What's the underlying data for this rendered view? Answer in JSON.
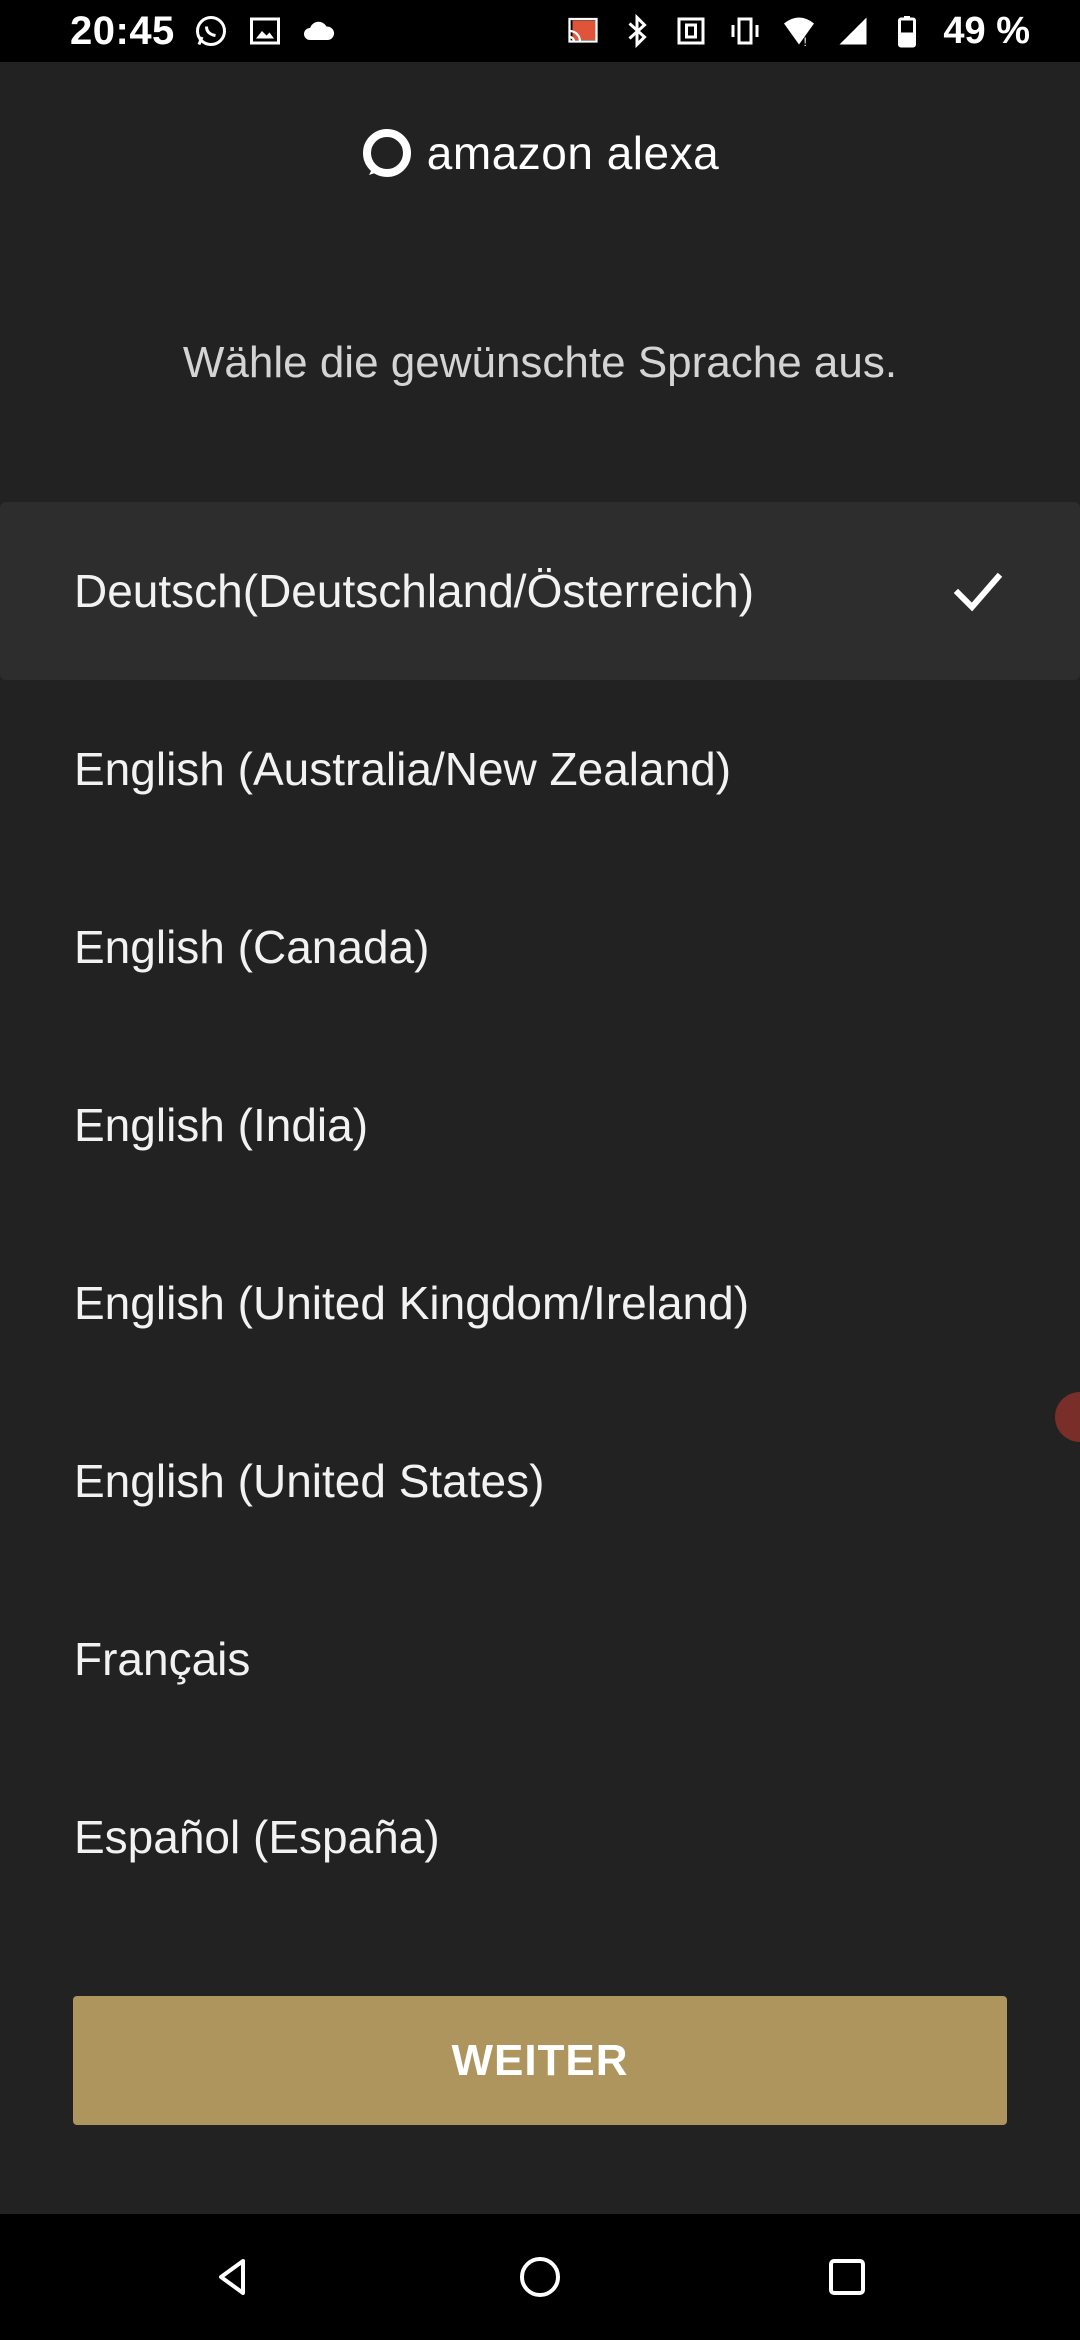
{
  "status_bar": {
    "time": "20:45",
    "left_icons": [
      "whatsapp-icon",
      "image-icon",
      "cloud-icon"
    ],
    "right_icons": [
      "cast-icon",
      "bluetooth-icon",
      "nfc-icon",
      "vibrate-icon",
      "wifi-icon",
      "signal-icon",
      "battery-icon"
    ],
    "battery": "49 %"
  },
  "header": {
    "logo_text": "amazon alexa"
  },
  "subtitle": "Wähle die gewünschte Sprache aus.",
  "languages": [
    {
      "label": "Deutsch(Deutschland/Österreich)",
      "selected": true
    },
    {
      "label": "English (Australia/New Zealand)",
      "selected": false
    },
    {
      "label": "English (Canada)",
      "selected": false
    },
    {
      "label": "English (India)",
      "selected": false
    },
    {
      "label": "English (United Kingdom/Ireland)",
      "selected": false
    },
    {
      "label": "English (United States)",
      "selected": false
    },
    {
      "label": "Français",
      "selected": false
    },
    {
      "label": "Español (España)",
      "selected": false
    }
  ],
  "continue_button": "WEITER",
  "nav_bar": {
    "icons": [
      "back-icon",
      "home-icon",
      "recents-icon"
    ]
  },
  "colors": {
    "background": "#222222",
    "selected_row": "#2d2d2d",
    "button": "#ae955e",
    "alexa_ring": "#ffffff"
  }
}
